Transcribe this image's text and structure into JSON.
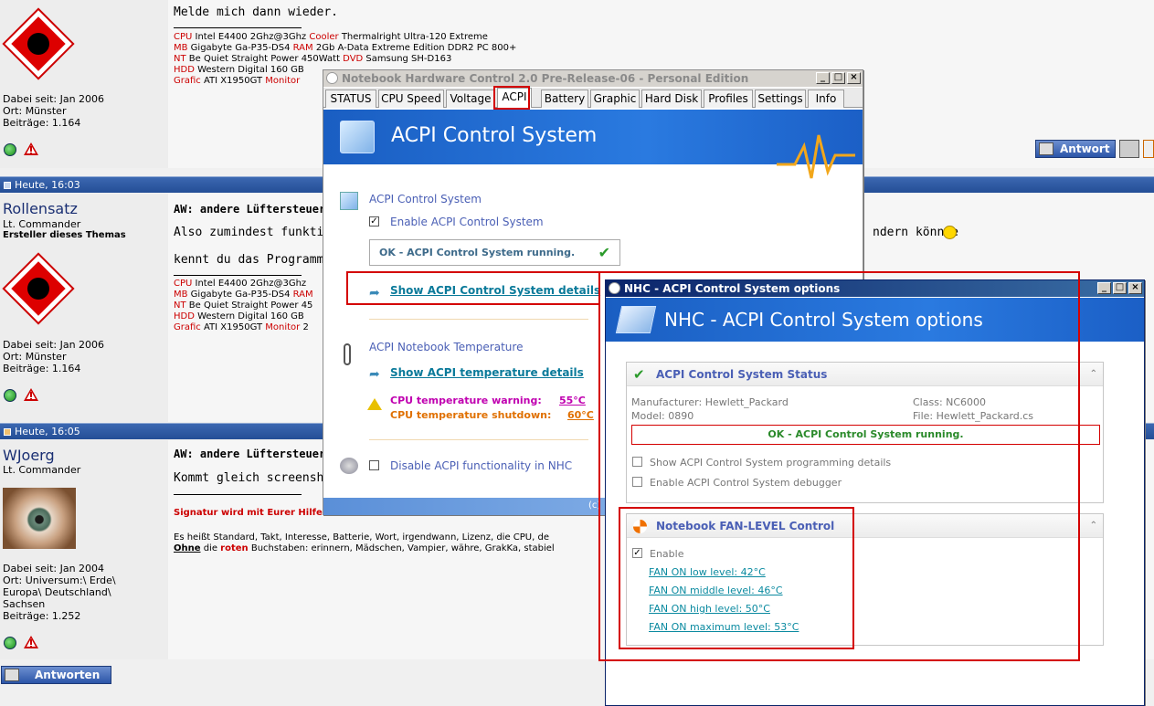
{
  "posts": [
    {
      "body_text": "Melde mich dann wieder.",
      "joined": "Dabei seit: Jan 2006",
      "location": "Ort: Münster",
      "posts_count": "Beiträge: 1.164",
      "sig": [
        {
          "l1": "CPU",
          "v1": " Intel E4400 2Ghz@3Ghz ",
          "l2": "Cooler",
          "v2": " Thermalright Ultra-120 Extreme"
        },
        {
          "l1": "MB",
          "v1": " Gigabyte Ga-P35-DS4 ",
          "l2": "RAM",
          "v2": " 2Gb A-Data Extreme Edition DDR2 PC 800+"
        },
        {
          "l1": "NT",
          "v1": " Be Quiet Straight Power 450Watt ",
          "l2": "DVD",
          "v2": " Samsung SH-D163"
        },
        {
          "l1": "HDD",
          "v1": " Western Digital 160 GB ",
          "l2": "",
          "v2": ""
        },
        {
          "l1": "Grafic",
          "v1": " ATI X1950GT ",
          "l2": "Monitor",
          "v2": ""
        }
      ],
      "reply_label": "Antwort"
    },
    {
      "time": "Heute, 16:03",
      "username": "Rollensatz",
      "rank": "Lt. Commander",
      "creator": "Ersteller dieses Themas",
      "title": "AW: andere Lüftersteuer",
      "body1": "Also zumindest funktionie",
      "body1_end": "ndern könnte",
      "body2": "kennt du das Programm?",
      "joined": "Dabei seit: Jan 2006",
      "location": "Ort: Münster",
      "posts_count": "Beiträge: 1.164",
      "sig": [
        {
          "l1": "CPU",
          "v1": " Intel E4400 2Ghz@3Ghz"
        },
        {
          "l1": "MB",
          "v1": " Gigabyte Ga-P35-DS4 "
        },
        {
          "l1": "NT",
          "v1": " Be Quiet Straight Power 45"
        },
        {
          "l1": "HDD",
          "v1": " Western Digital 160 GB"
        },
        {
          "l1": "Grafic",
          "v1": " ATI X1950GT ",
          "l2": "Monitor",
          "v2": " 2"
        }
      ],
      "sig_ram_label": "RAM"
    },
    {
      "time": "Heute, 16:05",
      "username": "WJoerg",
      "rank": "Lt. Commander",
      "title": "AW: andere Lüftersteuer",
      "body1": "Kommt gleich screenshot.",
      "sig_red": "Signatur wird mit Eurer Hilfe",
      "sig_line1": "Es heißt Standard, Takt, Interesse, Batterie, Wort, irgendwann, Lizenz, die CPU, de",
      "sig_line2_a": "Ohne",
      "sig_line2_b": " die ",
      "sig_line2_c": "roten",
      "sig_line2_d": " Buchstaben: erinnern, Mädschen, Vampier, währe, GrakKa, stabiel",
      "joined": "Dabei seit: Jan 2004",
      "location": "Ort: Universum:\\ Erde\\",
      "location2": "Europa\\ Deutschland\\",
      "location3": "Sachsen",
      "posts_count": "Beiträge: 1.252"
    }
  ],
  "reply_all_label": "Antworten",
  "nhc": {
    "title": "Notebook Hardware Control 2.0 Pre-Release-06  -  Personal Edition",
    "tabs": [
      "STATUS",
      "CPU Speed",
      "Voltage",
      "ACPI",
      "Battery",
      "Graphic",
      "Hard Disk",
      "Profiles",
      "Settings",
      "Info"
    ],
    "selected_tab": "ACPI",
    "banner_title": "ACPI Control System",
    "section1": "ACPI Control System",
    "enable_label": "Enable ACPI Control System",
    "status": "OK - ACPI Control System running.",
    "show_details": "Show ACPI Control System details",
    "section2": "ACPI Notebook Temperature",
    "show_temp": "Show ACPI temperature details",
    "warn_label": "CPU temperature warning:",
    "warn_value": "55°C",
    "shutdown_label": "CPU temperature shutdown:",
    "shutdown_value": "60°C",
    "disable_label": "Disable ACPI functionality in NHC",
    "footer_fragment": "(c)"
  },
  "opts": {
    "title": "NHC - ACPI Control System options",
    "banner_title": "NHC - ACPI Control System options",
    "status_head": "ACPI Control System Status",
    "manufacturer": "Manufacturer: Hewlett_Packard",
    "model": "Model: 0890",
    "class": "Class: NC6000",
    "file": "File: Hewlett_Packard.cs",
    "status": "OK - ACPI Control System running.",
    "cb1": "Show ACPI Control System programming details",
    "cb2": "Enable ACPI Control System debugger",
    "fan_head": "Notebook FAN-LEVEL Control",
    "fan_enable": "Enable",
    "fan_links": [
      "FAN ON low level: 42°C",
      "FAN ON middle level: 46°C",
      "FAN ON high level: 50°C",
      "FAN ON maximum level: 53°C"
    ]
  },
  "colors": {
    "accent_red": "#d40000",
    "forum_blue": "#244e96",
    "nhc_blue": "#1a5ec2"
  }
}
